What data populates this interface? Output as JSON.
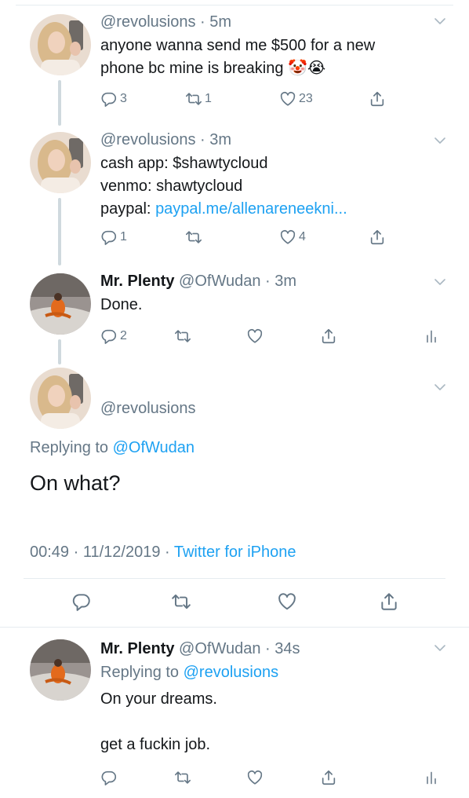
{
  "tweets": [
    {
      "handle": "@revolusions",
      "time": "5m",
      "line1": "anyone wanna send me $500 for a new",
      "line2": "phone bc mine is breaking 🤡😭",
      "replies": "3",
      "retweets": "1",
      "likes": "23"
    },
    {
      "handle": "@revolusions",
      "time": "3m",
      "line1": "cash app: $shawtycloud",
      "line2": "venmo: shawtycloud",
      "line3_prefix": "paypal: ",
      "line3_link": "paypal.me/allenareneekni...",
      "replies": "1",
      "likes": "4"
    },
    {
      "name": "Mr. Plenty",
      "handle": "@OfWudan",
      "time": "3m",
      "text": "Done.",
      "replies": "2"
    }
  ],
  "focused": {
    "handle": "@revolusions",
    "replying_prefix": "Replying to ",
    "replying_to": "@OfWudan",
    "text": "On what?",
    "datetime": "00:49 · 11/12/2019 · ",
    "source": "Twitter for iPhone"
  },
  "reply": {
    "name": "Mr. Plenty",
    "handle": "@OfWudan",
    "time": "34s",
    "replying_prefix": "Replying to ",
    "replying_to": "@revolusions",
    "line1": "On your dreams.",
    "line2": "get a fuckin job."
  },
  "colors": {
    "accent": "#1da1f2",
    "muted": "#657786",
    "text": "#14171a",
    "divider": "#e6ecf0"
  },
  "icons": [
    "reply-icon",
    "retweet-icon",
    "like-icon",
    "share-icon",
    "analytics-icon",
    "chevron-down-icon"
  ]
}
